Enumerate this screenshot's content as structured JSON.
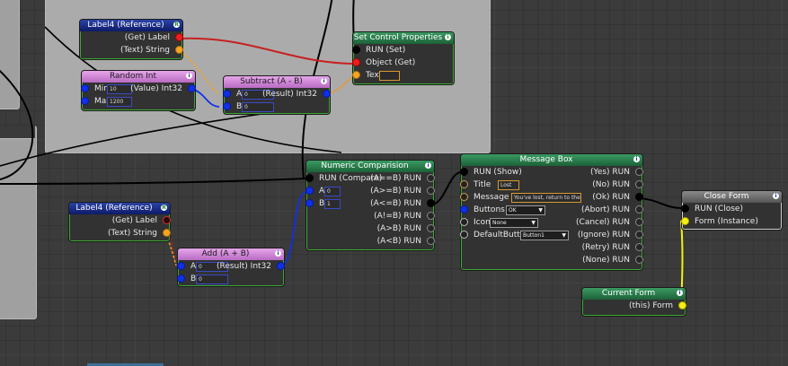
{
  "nodes": {
    "label4_top": {
      "title": "Label4 (Reference)",
      "get_label": "(Get) Label",
      "text_string": "(Text) String"
    },
    "random_int": {
      "title": "Random Int",
      "min_label": "Min",
      "min_value": "10",
      "max_label": "Max",
      "max_value": "1200",
      "out": "(Value) Int32"
    },
    "subtract": {
      "title": "Subtract (A - B)",
      "a_label": "A",
      "a_value": "0",
      "b_label": "B",
      "b_value": "0",
      "out": "(Result) Int32"
    },
    "set_control": {
      "title": "Set Control Properties",
      "run": "RUN (Set)",
      "object": "Object (Get)",
      "text": "Text"
    },
    "label4_bottom": {
      "title": "Label4 (Reference)",
      "get_label": "(Get) Label",
      "text_string": "(Text) String"
    },
    "add": {
      "title": "Add (A + B)",
      "a_label": "A",
      "a_value": "0",
      "b_label": "B",
      "b_value": "0",
      "out": "(Result) Int32"
    },
    "numeric_comparison": {
      "title": "Numeric Comparision",
      "run": "RUN (Compare)",
      "a_label": "A",
      "a_value": "0",
      "b_label": "B",
      "b_value": "1",
      "outputs": [
        "(A==B) RUN",
        "(A>=B) RUN",
        "(A<=B) RUN",
        "(A!=B) RUN",
        "(A>B) RUN",
        "(A<B) RUN"
      ]
    },
    "message_box": {
      "title": "Message Box",
      "run": "RUN (Show)",
      "title_label": "Title",
      "title_value": "Lost",
      "message_label": "Message",
      "message_value": "You've lost, return to the me",
      "buttons_label": "Buttons",
      "buttons_value": "OK",
      "icon_label": "Icon",
      "icon_value": "None",
      "default_label": "DefaultButton",
      "default_value": "Button1",
      "outputs": [
        "(Yes) RUN",
        "(No) RUN",
        "(Ok) RUN",
        "(Abort) RUN",
        "(Cancel) RUN",
        "(Ignore) RUN",
        "(Retry) RUN",
        "(None) RUN"
      ]
    },
    "close_form": {
      "title": "Close Form",
      "run": "RUN (Close)",
      "form": "Form (Instance)"
    },
    "current_form": {
      "title": "Current Form",
      "out": "(this) Form"
    }
  },
  "icons": {
    "info": "i",
    "ref": "R"
  },
  "colors": {
    "canvas": "#3b3b3b",
    "exec_wire": "#000000",
    "int_wire": "#1030e8",
    "object_wire": "#d02020",
    "string_wire": "#f5a522",
    "form_wire": "#f5f014"
  }
}
